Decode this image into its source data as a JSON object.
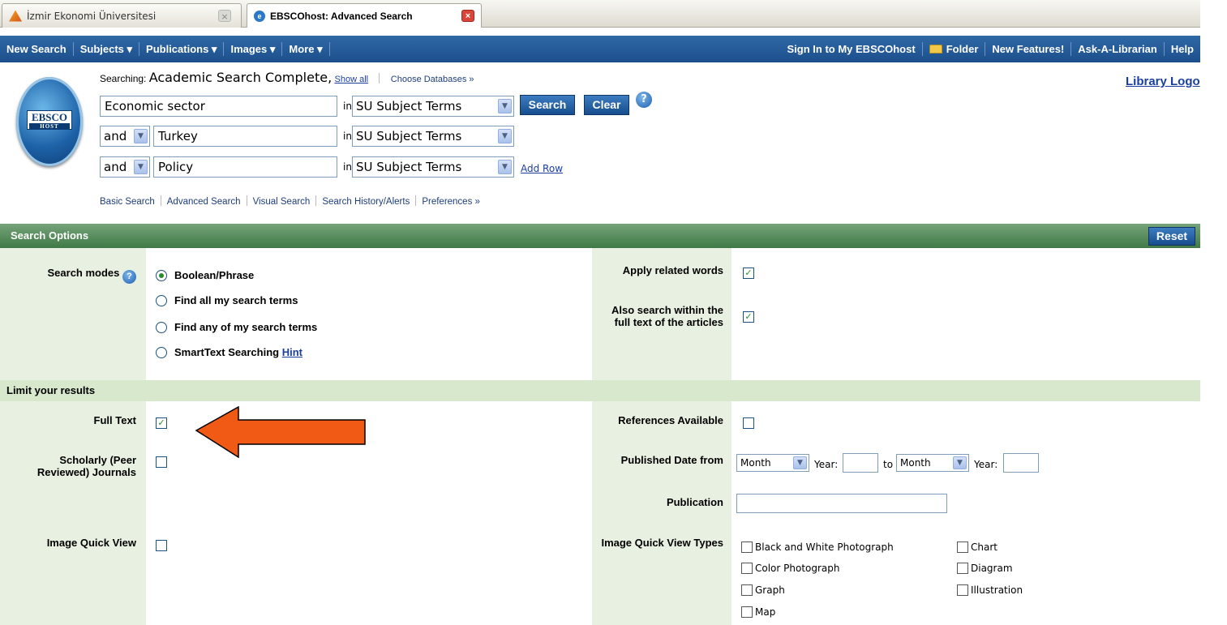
{
  "browser": {
    "tabs": [
      {
        "label": "İzmir Ekonomi Üniversitesi",
        "active": false
      },
      {
        "label": "EBSCOhost: Advanced Search",
        "active": true
      }
    ]
  },
  "topnav": {
    "left": [
      "New Search",
      "Subjects ▾",
      "Publications ▾",
      "Images ▾",
      "More ▾"
    ],
    "right": [
      "Sign In to My EBSCOhost",
      "Folder",
      "New Features!",
      "Ask-A-Librarian",
      "Help"
    ]
  },
  "search": {
    "searching_label": "Searching:",
    "database": "Academic Search Complete,",
    "show_all": "Show all",
    "choose_databases": "Choose Databases »",
    "library_logo": "Library Logo",
    "rows": [
      {
        "operator": "",
        "term": "Economic sector",
        "in": "in",
        "field": "SU Subject Terms"
      },
      {
        "operator": "and",
        "term": "Turkey",
        "in": "in",
        "field": "SU Subject Terms"
      },
      {
        "operator": "and",
        "term": "Policy",
        "in": "in",
        "field": "SU Subject Terms"
      }
    ],
    "search_button": "Search",
    "clear_button": "Clear",
    "add_row": "Add Row",
    "help_glyph": "?",
    "sublinks": [
      "Basic Search",
      "Advanced Search",
      "Visual Search",
      "Search History/Alerts",
      "Preferences »"
    ]
  },
  "logo": {
    "text": "EBSCO",
    "subtext": "HOST"
  },
  "options": {
    "header": "Search Options",
    "reset": "Reset",
    "search_modes_label": "Search modes",
    "modes": [
      {
        "label": "Boolean/Phrase",
        "selected": true
      },
      {
        "label": "Find all my search terms",
        "selected": false
      },
      {
        "label": "Find any of my search terms",
        "selected": false
      },
      {
        "label": "SmartText Searching",
        "selected": false
      }
    ],
    "hint": "Hint",
    "apply_related_words": "Apply related words",
    "also_search_fulltext": "Also search within the full text of the articles"
  },
  "limits": {
    "header": "Limit your results",
    "full_text": "Full Text",
    "scholarly": "Scholarly (Peer Reviewed) Journals",
    "image_quick_view": "Image Quick View",
    "references_available": "References Available",
    "published_date_from": "Published Date from",
    "month": "Month",
    "year": "Year:",
    "to": "to",
    "publication": "Publication",
    "image_quick_view_types": "Image Quick View Types",
    "types": [
      "Black and White Photograph",
      "Chart",
      "Color Photograph",
      "Diagram",
      "Graph",
      "Illustration",
      "Map"
    ]
  },
  "colors": {
    "nav_blue": "#1c4f8c",
    "options_green": "#3f7a46",
    "label_bg": "#e8f1e1",
    "annotation_arrow": "#f15a14"
  }
}
